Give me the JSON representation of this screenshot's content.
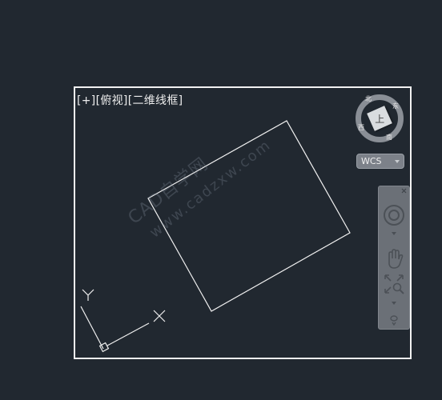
{
  "viewport": {
    "labels": [
      "[+]",
      "[俯视]",
      "[二维线框]"
    ]
  },
  "viewcube": {
    "face_label": "上",
    "north": "北",
    "east": "东",
    "west": "西",
    "south": "南"
  },
  "wcs": {
    "label": "WCS"
  },
  "ucs": {
    "y_label": "Y"
  },
  "watermark": {
    "line1": "CAD自学网",
    "line2": "www.cadzxw.com"
  },
  "colors": {
    "background": "#212830",
    "frame": "#f2f2f2",
    "navbar": "#6b7077"
  },
  "icons": [
    "steering-wheel-icon",
    "pan-hand-icon",
    "zoom-extents-icon",
    "orbit-icon"
  ]
}
